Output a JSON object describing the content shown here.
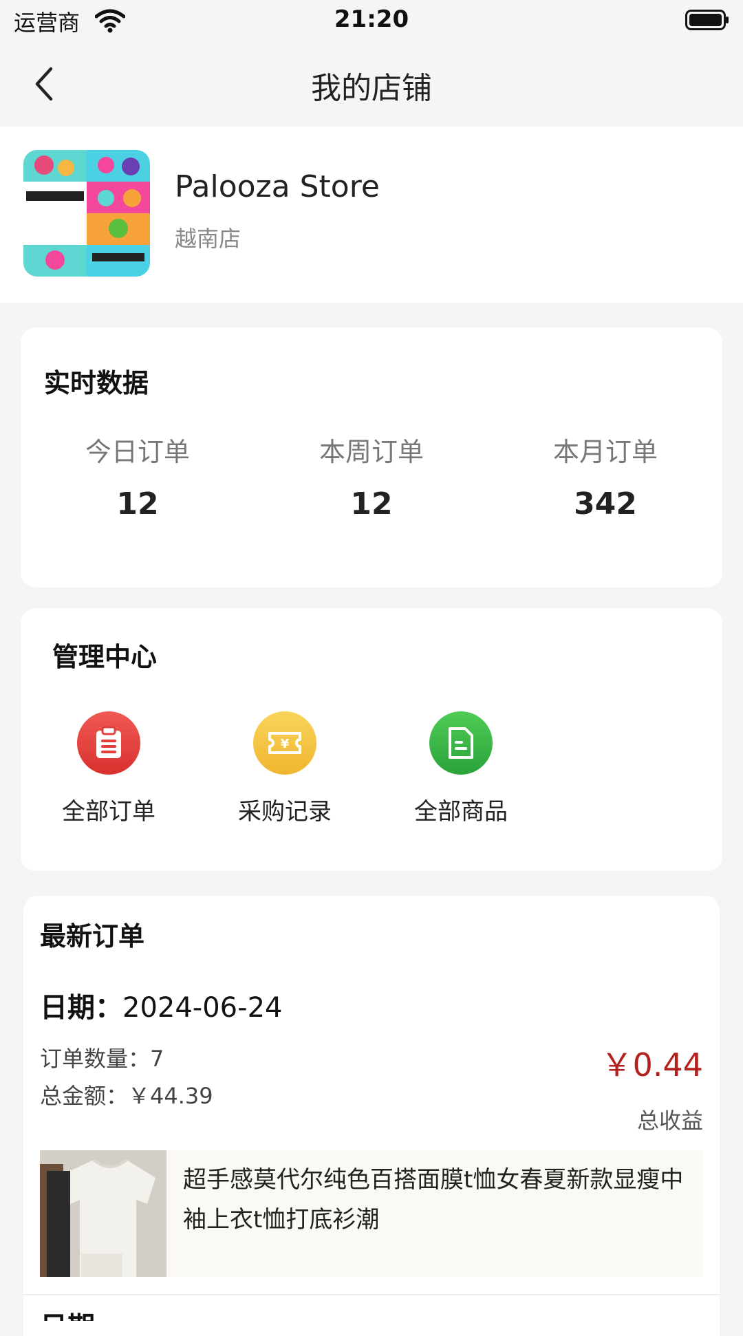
{
  "status_bar": {
    "carrier": "运营商",
    "time": "21:20"
  },
  "nav": {
    "title": "我的店铺"
  },
  "store": {
    "name": "Palooza Store",
    "subtitle": "越南店"
  },
  "realtime": {
    "title": "实时数据",
    "stats": [
      {
        "label": "今日订单",
        "value": "12"
      },
      {
        "label": "本周订单",
        "value": "12"
      },
      {
        "label": "本月订单",
        "value": "342"
      }
    ]
  },
  "management": {
    "title": "管理中心",
    "tools": [
      {
        "label": "全部订单",
        "icon": "clipboard-icon",
        "color": "#e8433f"
      },
      {
        "label": "采购记录",
        "icon": "ticket-yen-icon",
        "color": "#f3c13a"
      },
      {
        "label": "全部商品",
        "icon": "document-icon",
        "color": "#39b84a"
      }
    ]
  },
  "orders": {
    "title": "最新订单",
    "date_label": "日期：",
    "date": "2024-06-24",
    "count_label": "订单数量：",
    "count": "7",
    "total_label": "总金额：",
    "total": "￥44.39",
    "profit": "￥0.44",
    "profit_label": "总收益",
    "product": {
      "title": "超手感莫代尔纯色百搭面膜t恤女春夏新款显瘦中袖上衣t恤打底衫潮"
    },
    "next_date_label": "日期"
  },
  "colors": {
    "accent_price": "#b3211e",
    "background": "#f5f5f5"
  }
}
